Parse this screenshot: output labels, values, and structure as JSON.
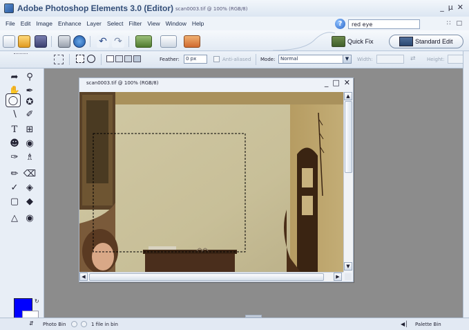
{
  "window": {
    "title": "Adobe Photoshop Elements 3.0 (Editor)",
    "subtitle": "scan0003.tif @ 100% (RGB/8)",
    "controls": [
      "_",
      "µ",
      "✕"
    ]
  },
  "menu": {
    "items": [
      "File",
      "Edit",
      "Image",
      "Enhance",
      "Layer",
      "Select",
      "Filter",
      "View",
      "Window",
      "Help"
    ],
    "search_value": "red eye",
    "right_controls": [
      "∷",
      "□"
    ]
  },
  "shortcuts": {
    "quick_fix_label": "Quick Fix",
    "standard_edit_label": "Standard Edit"
  },
  "options": {
    "feather_label": "Feather:",
    "feather_value": "0 px",
    "antialias_label": "Anti-aliased",
    "mode_label": "Mode:",
    "mode_value": "Normal",
    "width_label": "Width:",
    "height_label": "Height:"
  },
  "toolbox": {
    "foreground_color": "#0000ff",
    "background_color": "#ffffff"
  },
  "document": {
    "title": "scan0003.tif @ 100% (RGB/8)",
    "controls": [
      "_",
      "□",
      "✕"
    ]
  },
  "statusbar": {
    "photo_bin_label": "Photo Bin",
    "files_label": "1 file in bin",
    "palette_bin_label": "Palette Bin"
  }
}
